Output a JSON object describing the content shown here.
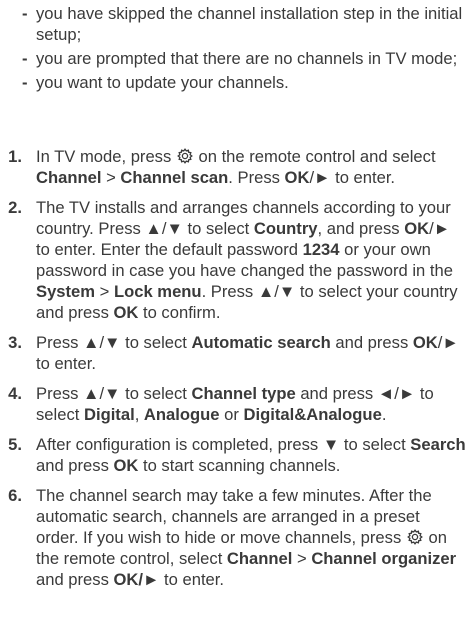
{
  "bullets": [
    "you have skipped the channel installation step in the initial setup;",
    "you are prompted that there are no channels in TV mode;",
    "you want to update your channels."
  ],
  "bullet_marker": "-",
  "steps": [
    {
      "number": "1.",
      "parts": [
        {
          "t": "In TV mode, press "
        },
        {
          "icon": "gear-icon"
        },
        {
          "t": " on the remote control and select "
        },
        {
          "t": "Channel",
          "b": true
        },
        {
          "t": " > "
        },
        {
          "t": "Channel scan",
          "b": true
        },
        {
          "t": ". Press "
        },
        {
          "t": "OK",
          "b": true
        },
        {
          "t": "/► to enter."
        }
      ]
    },
    {
      "number": "2.",
      "parts": [
        {
          "t": "The TV installs and arranges channels according to your country. Press ▲/▼ to select "
        },
        {
          "t": "Country",
          "b": true
        },
        {
          "t": ", and press "
        },
        {
          "t": "OK",
          "b": true
        },
        {
          "t": "/► to enter. Enter the default password "
        },
        {
          "t": "1234",
          "b": true
        },
        {
          "t": " or your own password in case you have changed the password in the "
        },
        {
          "t": "System",
          "b": true
        },
        {
          "t": " > "
        },
        {
          "t": "Lock menu",
          "b": true
        },
        {
          "t": ". Press ▲/▼ to select your country and press "
        },
        {
          "t": "OK",
          "b": true
        },
        {
          "t": " to confirm."
        }
      ]
    },
    {
      "number": "3.",
      "parts": [
        {
          "t": "Press ▲/▼ to select "
        },
        {
          "t": "Automatic search",
          "b": true
        },
        {
          "t": " and press "
        },
        {
          "t": "OK",
          "b": true
        },
        {
          "t": "/► to enter."
        }
      ]
    },
    {
      "number": "4.",
      "parts": [
        {
          "t": "Press ▲/▼ to select "
        },
        {
          "t": "Channel type",
          "b": true
        },
        {
          "t": " and press ◄/► to select "
        },
        {
          "t": "Digital",
          "b": true
        },
        {
          "t": ", "
        },
        {
          "t": "Analogue",
          "b": true
        },
        {
          "t": " or "
        },
        {
          "t": "Digital&Analogue",
          "b": true
        },
        {
          "t": "."
        }
      ]
    },
    {
      "number": "5.",
      "parts": [
        {
          "t": "After configuration is completed, press ▼ to select "
        },
        {
          "t": "Search",
          "b": true
        },
        {
          "t": " and press "
        },
        {
          "t": "OK",
          "b": true
        },
        {
          "t": " to start scanning channels."
        }
      ]
    },
    {
      "number": "6.",
      "parts": [
        {
          "t": "The channel search may take a few minutes. After the automatic search, channels are arranged in a preset order. If you wish to hide or move channels, press "
        },
        {
          "icon": "gear-icon"
        },
        {
          "t": " on the remote control, select "
        },
        {
          "t": "Channel",
          "b": true
        },
        {
          "t": " > "
        },
        {
          "t": "Channel organizer",
          "b": true
        },
        {
          "t": " and press "
        },
        {
          "t": "OK/►",
          "b": true
        },
        {
          "t": " to enter."
        }
      ]
    }
  ]
}
